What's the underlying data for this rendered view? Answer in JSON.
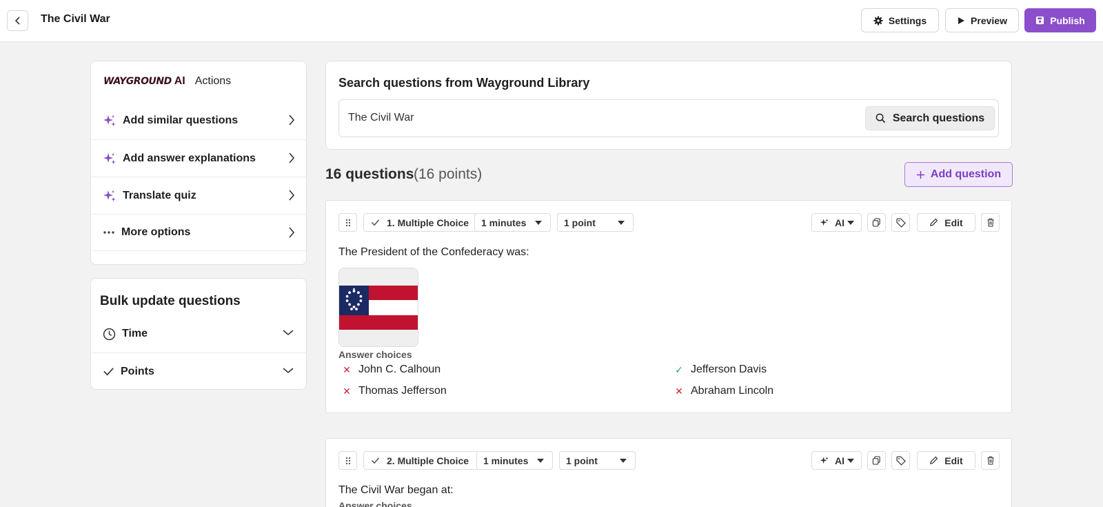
{
  "header": {
    "title": "The Civil War",
    "settings_label": "Settings",
    "preview_label": "Preview",
    "publish_label": "Publish"
  },
  "ai_panel": {
    "brand_word": "WAYGROUND",
    "brand_ai": "AI",
    "heading": "Actions",
    "items": [
      {
        "label": "Add similar questions",
        "icon": "sparkle-icon"
      },
      {
        "label": "Add answer explanations",
        "icon": "sparkle-icon"
      },
      {
        "label": "Translate quiz",
        "icon": "sparkle-icon"
      },
      {
        "label": "More options",
        "icon": "more-dots-icon"
      }
    ]
  },
  "bulk": {
    "title": "Bulk update questions",
    "items": [
      {
        "label": "Time",
        "icon": "clock-icon"
      },
      {
        "label": "Points",
        "icon": "check-icon"
      }
    ]
  },
  "search": {
    "title": "Search questions from Wayground Library",
    "value": "The Civil War",
    "button_label": "Search questions"
  },
  "summary": {
    "count": "16 questions",
    "points": "(16 points)",
    "add_label": "Add question"
  },
  "questions": [
    {
      "type_label": "1. Multiple Choice",
      "time": "1 minutes",
      "points": "1 point",
      "ai_label": "AI",
      "edit_label": "Edit",
      "text": "The President of the Confederacy was:",
      "answers_label": "Answer choices",
      "answers": [
        {
          "text": "John C. Calhoun",
          "correct": false
        },
        {
          "text": "Jefferson Davis",
          "correct": true
        },
        {
          "text": "Thomas Jefferson",
          "correct": false
        },
        {
          "text": "Abraham Lincoln",
          "correct": false
        }
      ]
    },
    {
      "type_label": "2. Multiple Choice",
      "time": "1 minutes",
      "points": "1 point",
      "ai_label": "AI",
      "edit_label": "Edit",
      "text": "The Civil War began at:",
      "answers_label": "Answer choices"
    }
  ],
  "colors": {
    "accent": "#8b4fcb",
    "correct": "#2c9b5f",
    "wrong": "#d1223b"
  }
}
